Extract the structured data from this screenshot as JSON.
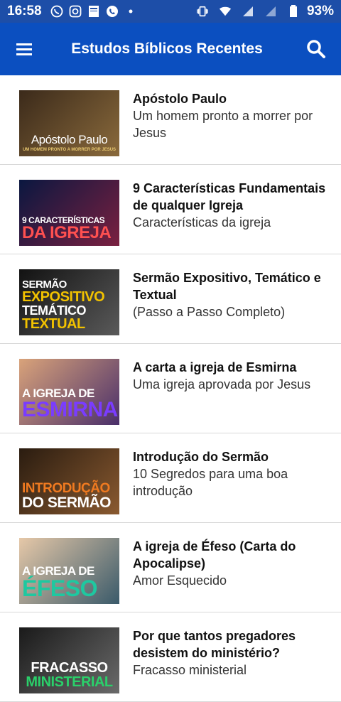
{
  "status_bar": {
    "time": "16:58",
    "battery": "93%",
    "icons": [
      "whatsapp-icon",
      "instagram-icon",
      "bible-app-icon",
      "phone-icon",
      "dot-icon",
      "vibrate-icon",
      "wifi-icon",
      "signal-icon",
      "signal-icon",
      "battery-icon"
    ]
  },
  "app_bar": {
    "title": "Estudos Bíblicos Recentes",
    "menu_icon": "hamburger-menu-icon",
    "search_icon": "search-icon",
    "color": "#0b4fc0"
  },
  "articles": [
    {
      "title": "Apóstolo Paulo",
      "subtitle": "Um homem pronto a morrer por Jesus",
      "thumb_text": [
        "Apóstolo Paulo"
      ],
      "thumb_sub": "UM HOMEM PRONTO A MORRER POR JESUS",
      "colors": [
        "#3b2a1a",
        "#8a6a3c"
      ]
    },
    {
      "title": "9 Características Fundamentais de qualquer Igreja",
      "subtitle": "Características da igreja",
      "thumb_text": [
        "9 CARACTERÍSTICAS",
        "DA IGREJA"
      ],
      "colors": [
        "#0a1740",
        "#7a2040"
      ]
    },
    {
      "title": "Sermão Expositivo, Temático e Textual",
      "subtitle": "(Passo a Passo Completo)",
      "thumb_text": [
        "SERMÃO",
        "EXPOSITIVO",
        "TEMÁTICO",
        "TEXTUAL"
      ],
      "colors": [
        "#121212",
        "#5a5a5a"
      ]
    },
    {
      "title": "A carta a igreja de Esmirna",
      "subtitle": "Uma igreja aprovada por Jesus",
      "thumb_text": [
        "A IGREJA DE",
        "ESMIRNA"
      ],
      "colors": [
        "#d9a37a",
        "#4a2f6a"
      ]
    },
    {
      "title": "Introdução do Sermão",
      "subtitle": "10 Segredos para uma boa introdução",
      "thumb_text": [
        "INTRODUÇÃO",
        "DO SERMÃO"
      ],
      "colors": [
        "#2a1c10",
        "#8a5a30"
      ]
    },
    {
      "title": "A igreja de Éfeso (Carta do Apocalipse)",
      "subtitle": "Amor Esquecido",
      "thumb_text": [
        "A IGREJA DE",
        "ÉFESO"
      ],
      "colors": [
        "#e6c8a8",
        "#3a5a6a"
      ]
    },
    {
      "title": "Por que tantos pregadores desistem do ministério?",
      "subtitle": "Fracasso ministerial",
      "thumb_text": [
        "FRACASSO",
        "MINISTERIAL"
      ],
      "colors": [
        "#1a1a1a",
        "#6a6a6a"
      ]
    }
  ]
}
